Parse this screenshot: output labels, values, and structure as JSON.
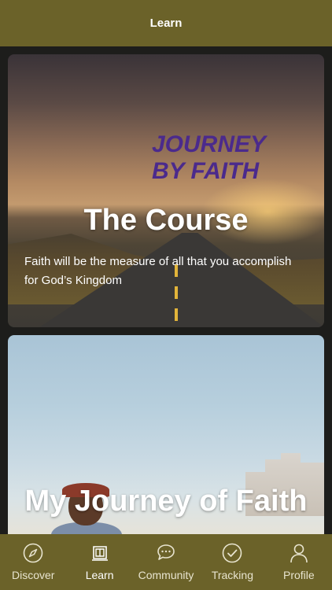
{
  "header": {
    "title": "Learn"
  },
  "cards": [
    {
      "brand_text": "JOURNEY BY FAITH",
      "title": "The Course",
      "description": "Faith will be the measure of all that you accomplish for God’s Kingdom"
    },
    {
      "title": "My Journey of Faith"
    }
  ],
  "tabs": [
    {
      "label": "Discover",
      "icon": "compass-icon",
      "active": false
    },
    {
      "label": "Learn",
      "icon": "book-icon",
      "active": true
    },
    {
      "label": "Community",
      "icon": "chat-icon",
      "active": false
    },
    {
      "label": "Tracking",
      "icon": "check-badge-icon",
      "active": false
    },
    {
      "label": "Profile",
      "icon": "user-icon",
      "active": false
    }
  ],
  "colors": {
    "bar_background": "#6b6229",
    "page_background": "#1d1d1b"
  }
}
